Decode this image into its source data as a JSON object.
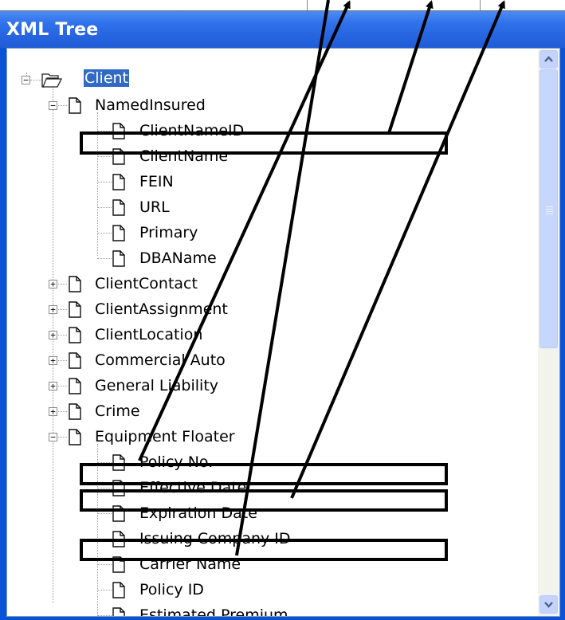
{
  "window": {
    "title": "XML Tree"
  },
  "tree": {
    "root": {
      "label": "Client",
      "selected": true
    },
    "items": [
      {
        "label": "NamedInsured",
        "expander": "minus"
      },
      {
        "label": "ClientNameID",
        "expander": ""
      },
      {
        "label": "ClientName",
        "expander": ""
      },
      {
        "label": "FEIN",
        "expander": ""
      },
      {
        "label": "URL",
        "expander": ""
      },
      {
        "label": "Primary",
        "expander": ""
      },
      {
        "label": "DBAName",
        "expander": ""
      },
      {
        "label": "ClientContact",
        "expander": "plus"
      },
      {
        "label": "ClientAssignment",
        "expander": "plus"
      },
      {
        "label": "ClientLocation",
        "expander": "plus"
      },
      {
        "label": "Commercial Auto",
        "expander": "plus"
      },
      {
        "label": "General Liability",
        "expander": "plus"
      },
      {
        "label": "Crime",
        "expander": "plus"
      },
      {
        "label": "Equipment Floater",
        "expander": "minus"
      },
      {
        "label": "Policy No.",
        "expander": ""
      },
      {
        "label": "Effective Date",
        "expander": ""
      },
      {
        "label": "Expiration Date",
        "expander": ""
      },
      {
        "label": "Issuing Company ID",
        "expander": ""
      },
      {
        "label": "Carrier Name",
        "expander": ""
      },
      {
        "label": "Policy ID",
        "expander": ""
      },
      {
        "label": "Estimated Premium",
        "expander": ""
      }
    ]
  },
  "icons": {
    "folder": "folder-open-icon",
    "node": "document-icon",
    "scroll_up": "arrow-up-icon",
    "scroll_down": "arrow-down-icon"
  },
  "colors": {
    "title_bar": "#2f6fe9",
    "selection": "#316ac5",
    "scrollbar": "#c3d3fd",
    "frame_border": "#0a52d8"
  }
}
